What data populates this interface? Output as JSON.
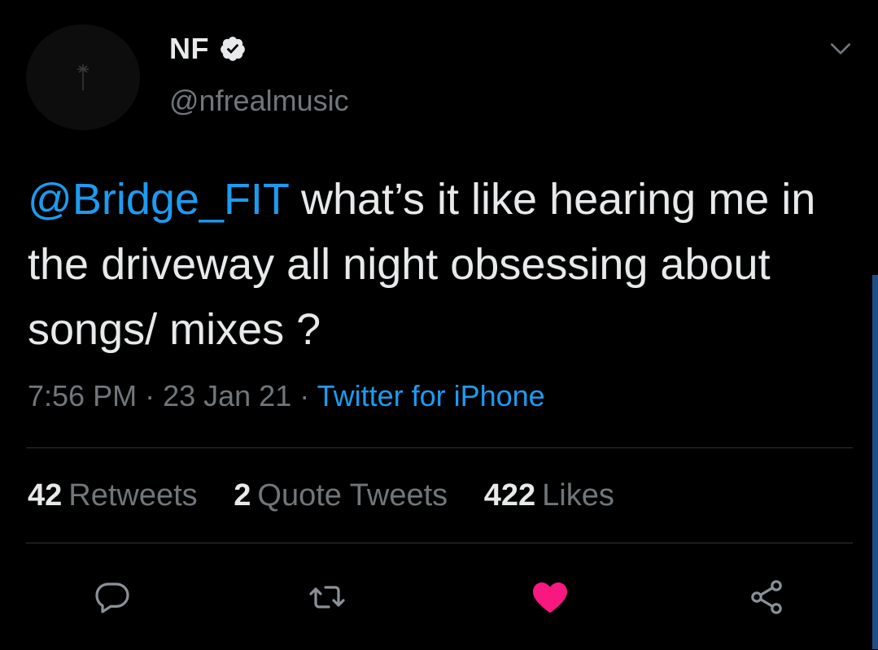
{
  "author": {
    "display_name": "NF",
    "handle": "@nfrealmusic",
    "verified": true,
    "avatar_icon": "nf-logo-avatar-icon"
  },
  "tweet": {
    "mention": "@Bridge_FIT",
    "text": " what’s it like hearing me in the driveway all night obsessing about songs/ mixes ?",
    "time": "7:56 PM",
    "separator": " · ",
    "date": "23 Jan 21",
    "source": "Twitter for iPhone"
  },
  "stats": {
    "retweets_count": "42",
    "retweets_label": "Retweets",
    "quotes_count": "2",
    "quotes_label": "Quote Tweets",
    "likes_count": "422",
    "likes_label": "Likes"
  },
  "actions": [
    {
      "name": "reply",
      "icon": "reply-icon"
    },
    {
      "name": "retweet",
      "icon": "retweet-icon"
    },
    {
      "name": "like",
      "icon": "heart-icon",
      "active": true
    },
    {
      "name": "share",
      "icon": "share-icon"
    }
  ],
  "colors": {
    "background": "#000000",
    "text": "#e7e9ea",
    "secondary": "#71767b",
    "accent": "#1d9bf0",
    "like": "#f91880"
  }
}
